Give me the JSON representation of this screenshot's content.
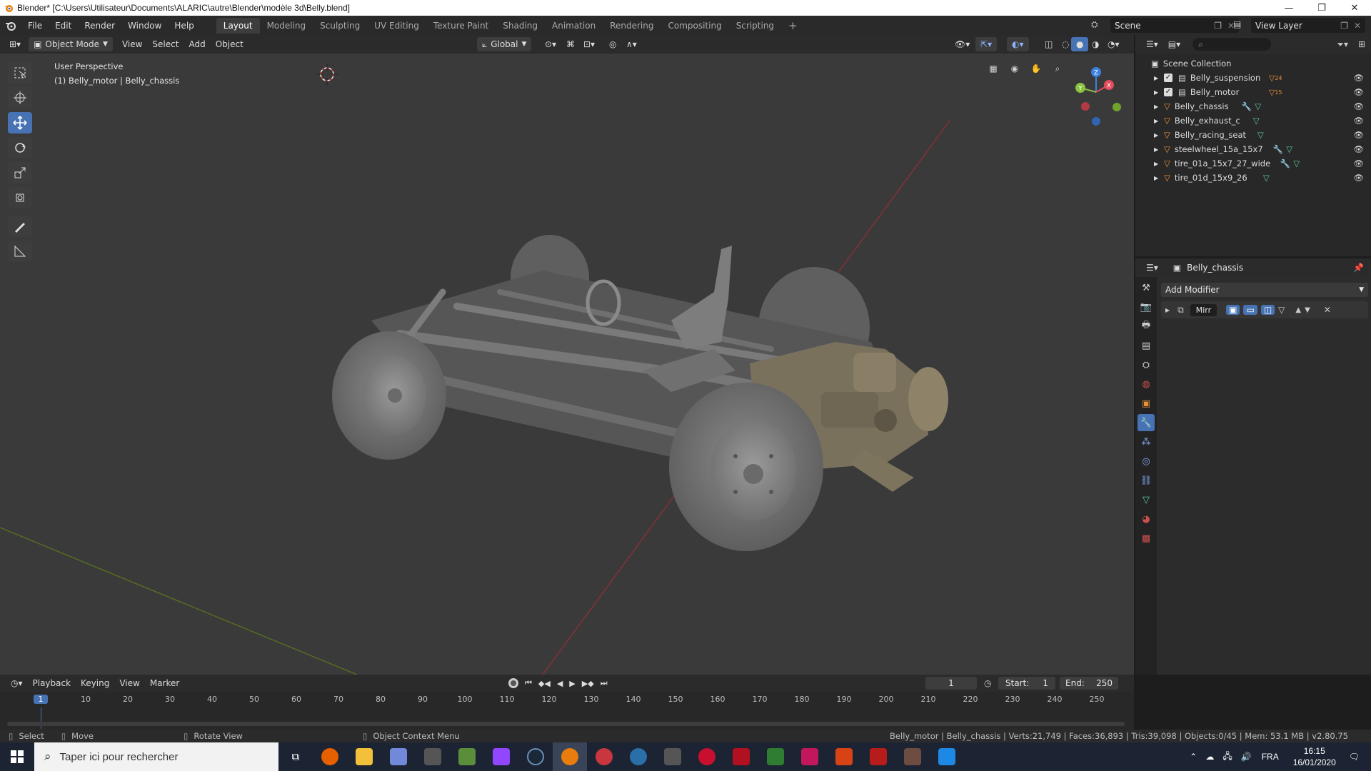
{
  "window": {
    "title": "Blender* [C:\\Users\\Utilisateur\\Documents\\ALARIC\\autre\\Blender\\modèle 3d\\Belly.blend]",
    "minimize": "—",
    "restore": "❐",
    "close": "✕"
  },
  "menu": [
    "File",
    "Edit",
    "Render",
    "Window",
    "Help"
  ],
  "workspaces": [
    {
      "label": "Layout",
      "active": true
    },
    {
      "label": "Modeling"
    },
    {
      "label": "Sculpting"
    },
    {
      "label": "UV Editing"
    },
    {
      "label": "Texture Paint"
    },
    {
      "label": "Shading"
    },
    {
      "label": "Animation"
    },
    {
      "label": "Rendering"
    },
    {
      "label": "Compositing"
    },
    {
      "label": "Scripting"
    }
  ],
  "add_workspace": "+",
  "scene": "Scene",
  "view_layer": "View Layer",
  "viewport": {
    "mode": "Object Mode",
    "menus": [
      "View",
      "Select",
      "Add",
      "Object"
    ],
    "transform_orientation": "Global",
    "perspective_label": "User Perspective",
    "object_label": "(1) Belly_motor | Belly_chassis",
    "gizmo": {
      "x": "X",
      "y": "Y",
      "z": "Z"
    }
  },
  "outliner": {
    "collection": "Scene Collection",
    "items": [
      {
        "name": "Belly_suspension",
        "extra": "24",
        "kind": "collection"
      },
      {
        "name": "Belly_motor",
        "extra": "15",
        "kind": "collection"
      },
      {
        "name": "Belly_chassis",
        "kind": "mesh",
        "selected": true
      },
      {
        "name": "Belly_exhaust_c",
        "kind": "mesh"
      },
      {
        "name": "Belly_racing_seat",
        "kind": "mesh"
      },
      {
        "name": "steelwheel_15a_15x7",
        "kind": "mesh"
      },
      {
        "name": "tire_01a_15x7_27_wide",
        "kind": "mesh"
      },
      {
        "name": "tire_01d_15x9_26",
        "kind": "mesh"
      }
    ]
  },
  "properties": {
    "object_name": "Belly_chassis",
    "add_modifier": "Add Modifier",
    "modifier_name": "Mirr"
  },
  "timeline": {
    "menus": [
      "Playback",
      "Keying",
      "View",
      "Marker"
    ],
    "current_frame": "1",
    "start_label": "Start:",
    "start_value": "1",
    "end_label": "End:",
    "end_value": "250",
    "ticks": [
      "1",
      "10",
      "20",
      "30",
      "40",
      "50",
      "60",
      "70",
      "80",
      "90",
      "100",
      "110",
      "120",
      "130",
      "140",
      "150",
      "160",
      "170",
      "180",
      "190",
      "200",
      "210",
      "220",
      "230",
      "240",
      "250"
    ]
  },
  "statusbar": {
    "select": "Select",
    "move": "Move",
    "rotate": "Rotate View",
    "context": "Object Context Menu",
    "stats": "Belly_motor | Belly_chassis | Verts:21,749 | Faces:36,893 | Tris:39,098 | Objects:0/45 | Mem: 53.1 MB | v2.80.75"
  },
  "taskbar": {
    "search_placeholder": "Taper ici pour rechercher",
    "language": "FRA",
    "time": "16:15",
    "date": "16/01/2020"
  },
  "colors": {
    "accent": "#4772b3",
    "x_axis": "#e34c5a",
    "y_axis": "#8ac43f",
    "z_axis": "#3b82e0",
    "object_orange": "#e8903a",
    "mesh_green": "#5ec9a8"
  }
}
